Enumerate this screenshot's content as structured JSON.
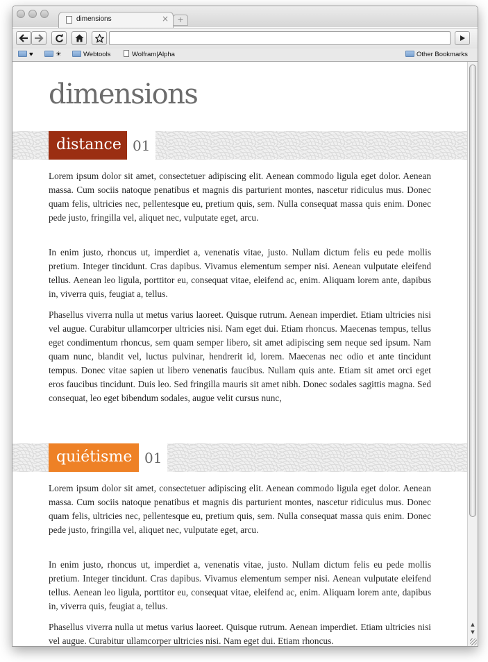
{
  "browser": {
    "tab_title": "dimensions",
    "tab_close_glyph": "×",
    "newtab_glyph": "+",
    "omnibox_value": "",
    "bookmarks": [
      {
        "label": "♥",
        "kind": "folder"
      },
      {
        "label": "☀",
        "kind": "folder"
      },
      {
        "label": "Webtools",
        "kind": "folder"
      },
      {
        "label": "Wolfram|Alpha",
        "kind": "page"
      }
    ],
    "other_bookmarks": "Other Bookmarks"
  },
  "icons": {
    "back": "arrow-left-icon",
    "forward": "arrow-right-icon",
    "reload": "reload-icon",
    "home": "home-icon",
    "star": "star-icon",
    "go": "play-icon",
    "new_tab": "plus-icon",
    "folder": "folder-icon",
    "page": "page-icon"
  },
  "page": {
    "title": "dimensions",
    "sections": [
      {
        "label": "distance",
        "number": "01",
        "label_color": "#9b2e12",
        "paragraphs": [
          "Lorem ipsum dolor sit amet, consectetuer adipiscing elit. Aenean commodo ligula eget dolor. Aenean massa. Cum sociis natoque penatibus et magnis dis parturient montes, nascetur ridiculus mus. Donec quam felis, ultricies nec, pellentesque eu, pretium quis, sem. Nulla consequat massa quis enim. Donec pede justo, fringilla vel, aliquet nec, vulputate eget, arcu.",
          "In enim justo, rhoncus ut, imperdiet a, venenatis vitae, justo. Nullam dictum felis eu pede mollis pretium. Integer tincidunt. Cras dapibus. Vivamus elementum semper nisi. Aenean vulputate eleifend tellus. Aenean leo ligula, porttitor eu, consequat vitae, eleifend ac, enim. Aliquam lorem ante, dapibus in, viverra quis, feugiat a, tellus.",
          "Phasellus viverra nulla ut metus varius laoreet. Quisque rutrum. Aenean imperdiet. Etiam ultricies nisi vel augue. Curabitur ullamcorper ultricies nisi. Nam eget dui. Etiam rhoncus. Maecenas tempus, tellus eget condimentum rhoncus, sem quam semper libero, sit amet adipiscing sem neque sed ipsum. Nam quam nunc, blandit vel, luctus pulvinar, hendrerit id, lorem. Maecenas nec odio et ante tincidunt tempus. Donec vitae sapien ut libero venenatis faucibus. Nullam quis ante. Etiam sit amet orci eget eros faucibus tincidunt. Duis leo. Sed fringilla mauris sit amet nibh. Donec sodales sagittis magna. Sed consequat, leo eget bibendum sodales, augue velit cursus nunc,"
        ]
      },
      {
        "label": "quiétisme",
        "number": "01",
        "label_color": "#ee8126",
        "paragraphs": [
          "Lorem ipsum dolor sit amet, consectetuer adipiscing elit. Aenean commodo ligula eget dolor. Aenean massa. Cum sociis natoque penatibus et magnis dis parturient montes, nascetur ridiculus mus. Donec quam felis, ultricies nec, pellentesque eu, pretium quis, sem. Nulla consequat massa quis enim. Donec pede justo, fringilla vel, aliquet nec, vulputate eget, arcu.",
          "In enim justo, rhoncus ut, imperdiet a, venenatis vitae, justo. Nullam dictum felis eu pede mollis pretium. Integer tincidunt. Cras dapibus. Vivamus elementum semper nisi. Aenean vulputate eleifend tellus. Aenean leo ligula, porttitor eu, consequat vitae, eleifend ac, enim. Aliquam lorem ante, dapibus in, viverra quis, feugiat a, tellus.",
          "Phasellus viverra nulla ut metus varius laoreet. Quisque rutrum. Aenean imperdiet. Etiam ultricies nisi vel augue. Curabitur ullamcorper ultricies nisi. Nam eget dui. Etiam rhoncus."
        ]
      }
    ]
  }
}
